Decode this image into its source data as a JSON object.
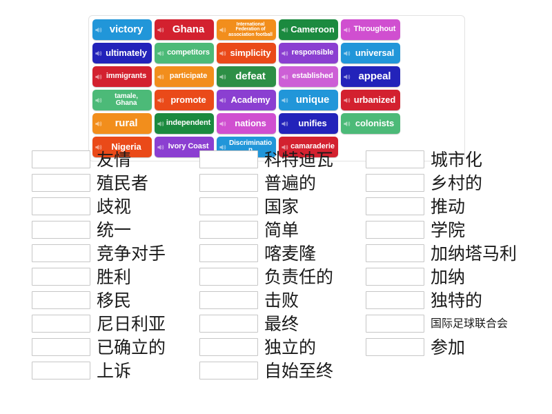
{
  "activity": {
    "type": "match-up",
    "icon_name": "speaker-icon"
  },
  "tile_bank": {
    "name": "word-tile-bank",
    "tiles": [
      {
        "label": "victory",
        "color": "#2196d9",
        "size": "lg"
      },
      {
        "label": "Ghana",
        "color": "#d3212f",
        "size": "lg"
      },
      {
        "label": "International Federation of association football",
        "color": "#f28e1c",
        "size": "xxs"
      },
      {
        "label": "Cameroon",
        "color": "#1b8a3f",
        "size": "md"
      },
      {
        "label": "Throughout",
        "color": "#d04fd0",
        "size": "sm"
      },
      {
        "label": "ultimately",
        "color": "#2323ba",
        "size": "md"
      },
      {
        "label": "competitors",
        "color": "#4cba78",
        "size": "sm"
      },
      {
        "label": "simplicity",
        "color": "#ea4a19",
        "size": "md"
      },
      {
        "label": "responsible",
        "color": "#8b3fd1",
        "size": "sm"
      },
      {
        "label": "universal",
        "color": "#2196d9",
        "size": "md"
      },
      {
        "label": "immigrants",
        "color": "#d3212f",
        "size": "sm"
      },
      {
        "label": "participate",
        "color": "#f28e1c",
        "size": "sm"
      },
      {
        "label": "defeat",
        "color": "#2d8f46",
        "size": "lg"
      },
      {
        "label": "established",
        "color": "#cd5fd6",
        "size": "sm"
      },
      {
        "label": "appeal",
        "color": "#2323ba",
        "size": "lg"
      },
      {
        "label": "tamale, Ghana",
        "color": "#4cba78",
        "size": "xs"
      },
      {
        "label": "promote",
        "color": "#ea4a19",
        "size": "md"
      },
      {
        "label": "Academy",
        "color": "#8b3fd1",
        "size": "md"
      },
      {
        "label": "unique",
        "color": "#2196d9",
        "size": "lg"
      },
      {
        "label": "urbanized",
        "color": "#d3212f",
        "size": "md"
      },
      {
        "label": "rural",
        "color": "#f28e1c",
        "size": "lg"
      },
      {
        "label": "independent",
        "color": "#1b8a3f",
        "size": "sm"
      },
      {
        "label": "nations",
        "color": "#d04fd0",
        "size": "md"
      },
      {
        "label": "unifies",
        "color": "#2323ba",
        "size": "md"
      },
      {
        "label": "colonists",
        "color": "#4cba78",
        "size": "md"
      },
      {
        "label": "Nigeria",
        "color": "#ea4a19",
        "size": "md"
      },
      {
        "label": "Ivory Coast",
        "color": "#8b3fd1",
        "size": "sm"
      },
      {
        "label": "Discrimination",
        "color": "#2196d9",
        "size": "xs"
      },
      {
        "label": "camaraderie",
        "color": "#d3212f",
        "size": "sm"
      }
    ]
  },
  "answer_columns": [
    {
      "name": "answer-column-1",
      "rows": [
        {
          "label": "友情",
          "size": "normal"
        },
        {
          "label": "殖民者",
          "size": "normal"
        },
        {
          "label": "歧视",
          "size": "normal"
        },
        {
          "label": "统一",
          "size": "normal"
        },
        {
          "label": "竞争对手",
          "size": "normal"
        },
        {
          "label": "胜利",
          "size": "normal"
        },
        {
          "label": "移民",
          "size": "normal"
        },
        {
          "label": "尼日利亚",
          "size": "normal"
        },
        {
          "label": "已确立的",
          "size": "normal"
        },
        {
          "label": "上诉",
          "size": "normal"
        }
      ]
    },
    {
      "name": "answer-column-2",
      "rows": [
        {
          "label": "科特迪瓦",
          "size": "normal"
        },
        {
          "label": "普遍的",
          "size": "normal"
        },
        {
          "label": "国家",
          "size": "normal"
        },
        {
          "label": "简单",
          "size": "normal"
        },
        {
          "label": "喀麦隆",
          "size": "normal"
        },
        {
          "label": "负责任的",
          "size": "normal"
        },
        {
          "label": "击败",
          "size": "normal"
        },
        {
          "label": "最终",
          "size": "normal"
        },
        {
          "label": "独立的",
          "size": "normal"
        },
        {
          "label": "自始至终",
          "size": "normal"
        }
      ]
    },
    {
      "name": "answer-column-3",
      "rows": [
        {
          "label": "城市化",
          "size": "normal"
        },
        {
          "label": "乡村的",
          "size": "normal"
        },
        {
          "label": "推动",
          "size": "normal"
        },
        {
          "label": "学院",
          "size": "normal"
        },
        {
          "label": "加纳塔马利",
          "size": "normal"
        },
        {
          "label": "加纳",
          "size": "normal"
        },
        {
          "label": "独特的",
          "size": "normal"
        },
        {
          "label": "国际足球联合会",
          "size": "small"
        },
        {
          "label": "参加",
          "size": "normal"
        }
      ]
    }
  ]
}
